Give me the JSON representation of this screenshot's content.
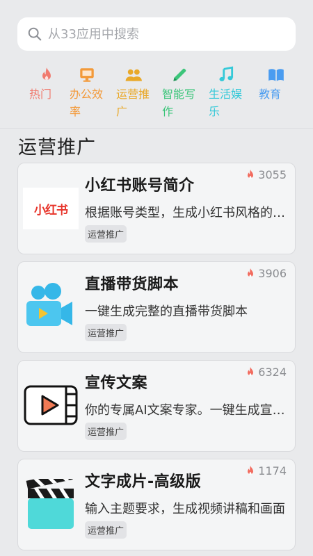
{
  "search": {
    "placeholder": "从33应用中搜索"
  },
  "categories": [
    {
      "label": "热门",
      "icon": "fire-icon",
      "color": "#f07a6e"
    },
    {
      "label": "办公效率",
      "icon": "monitor-icon",
      "color": "#f39a3a"
    },
    {
      "label": "运营推广",
      "icon": "users-icon",
      "color": "#e9a92a"
    },
    {
      "label": "智能写作",
      "icon": "pencil-icon",
      "color": "#3cc57a"
    },
    {
      "label": "生活娱乐",
      "icon": "music-icon",
      "color": "#35c9d8"
    },
    {
      "label": "教育",
      "icon": "book-icon",
      "color": "#4a9cf0"
    }
  ],
  "section": {
    "title": "运营推广"
  },
  "cards": [
    {
      "title": "小红书账号简介",
      "desc": "根据账号类型，生成小红书风格的账号简介",
      "tag": "运营推广",
      "count": "3055",
      "thumb": "xiaohongshu-logo",
      "logo_text": "小红书"
    },
    {
      "title": "直播带货脚本",
      "desc": "一键生成完整的直播带货脚本",
      "tag": "运营推广",
      "count": "3906",
      "thumb": "video-camera-icon"
    },
    {
      "title": "宣传文案",
      "desc": "你的专属AI文案专家。一键生成宣传文案",
      "tag": "运营推广",
      "count": "6324",
      "thumb": "play-video-icon"
    },
    {
      "title": "文字成片-高级版",
      "desc": "输入主题要求，生成视频讲稿和画面",
      "tag": "运营推广",
      "count": "1174",
      "thumb": "clapperboard-icon"
    }
  ],
  "colors": {
    "hot": "#f26b5e",
    "accent_red": "#e7352b"
  }
}
